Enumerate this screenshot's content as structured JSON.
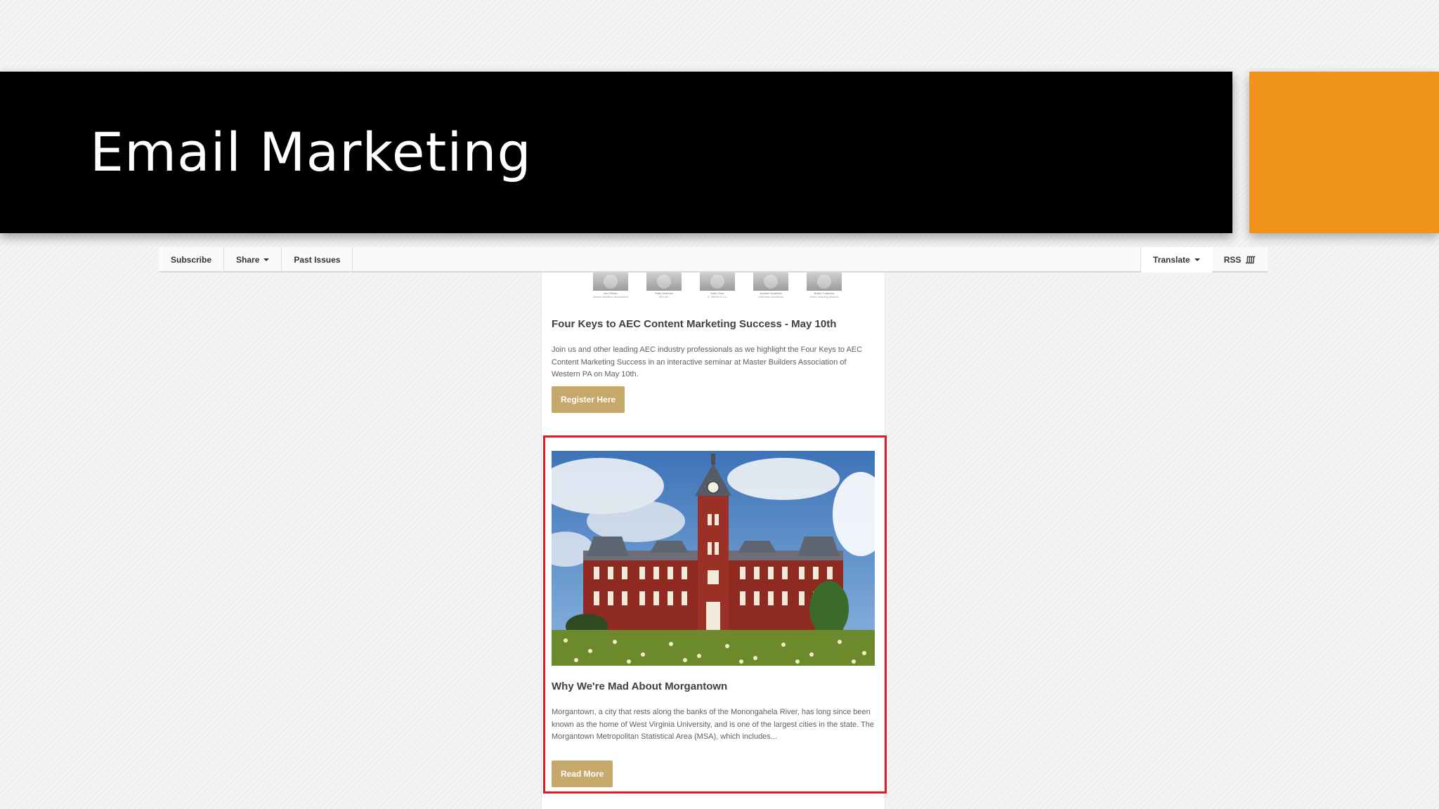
{
  "slide": {
    "title": "Email Marketing",
    "accent_color": "#f0931b"
  },
  "toolbar": {
    "subscribe": "Subscribe",
    "share": "Share",
    "past_issues": "Past Issues",
    "translate": "Translate",
    "rss": "RSS"
  },
  "speakers": [
    {
      "name": "Jon O'Brien",
      "org": "Master Builders' Association"
    },
    {
      "name": "Patty Sedlmire",
      "org": "IKM Inc."
    },
    {
      "name": "Katie Gore",
      "org": "A. Martini & Co."
    },
    {
      "name": "Andrew Opaliński",
      "org": "Desmone Architects"
    },
    {
      "name": "Brahé Colassira",
      "org": "Green Building Alliance"
    }
  ],
  "article1": {
    "heading": "Four Keys to AEC Content Marketing Success - May 10th",
    "body": "Join us and other leading AEC industry professionals as we highlight the Four Keys to AEC Content Marketing Success in an interactive seminar at Master Builders Association of Western PA on May 10th.",
    "button": "Register Here"
  },
  "article2": {
    "heading": "Why We're Mad About Morgantown",
    "body": "Morgantown, a city that rests along the banks of the Monongahela River, has long since been known as the home of West Virginia University, and is one of the largest cities in the state. The Morgantown Metropolitan Statistical Area (MSA), which includes...",
    "button": "Read More"
  },
  "colors": {
    "button": "#c6a96a",
    "highlight": "#d81f26"
  }
}
